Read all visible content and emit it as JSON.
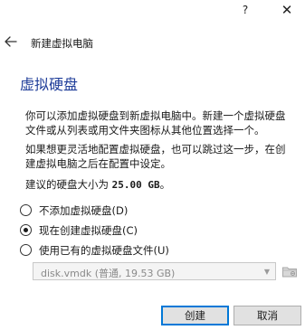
{
  "titlebar": {
    "help_glyph": "?",
    "close_glyph": "✕"
  },
  "nav": {
    "title": "新建虚拟电脑"
  },
  "page": {
    "heading": "虚拟硬盘",
    "para1_line1": "你可以添加虚拟硬盘到新虚拟电脑中。新建一个虚拟硬盘",
    "para1_line2": "文件或从列表或用文件夹图标从其他位置选择一个。",
    "para2_line1": "如果想更灵活地配置虚拟硬盘，也可以跳过这一步，在创",
    "para2_line2": "建虚拟电脑之后在配置中设定。",
    "size_prefix": "建议的硬盘大小为 ",
    "size_value": "25.00 GB",
    "size_suffix": "。"
  },
  "options": {
    "no_disk": "不添加虚拟硬盘(D)",
    "create_new": "现在创建虚拟硬盘(C)",
    "use_existing": "使用已有的虚拟硬盘文件(U)",
    "selected": "create_new"
  },
  "existing_file": {
    "value": "disk.vmdk (普通, 19.53 GB)"
  },
  "buttons": {
    "create": "创建",
    "cancel": "取消"
  },
  "colors": {
    "heading": "#1f3d99",
    "default_button_border": "#0078d7"
  }
}
